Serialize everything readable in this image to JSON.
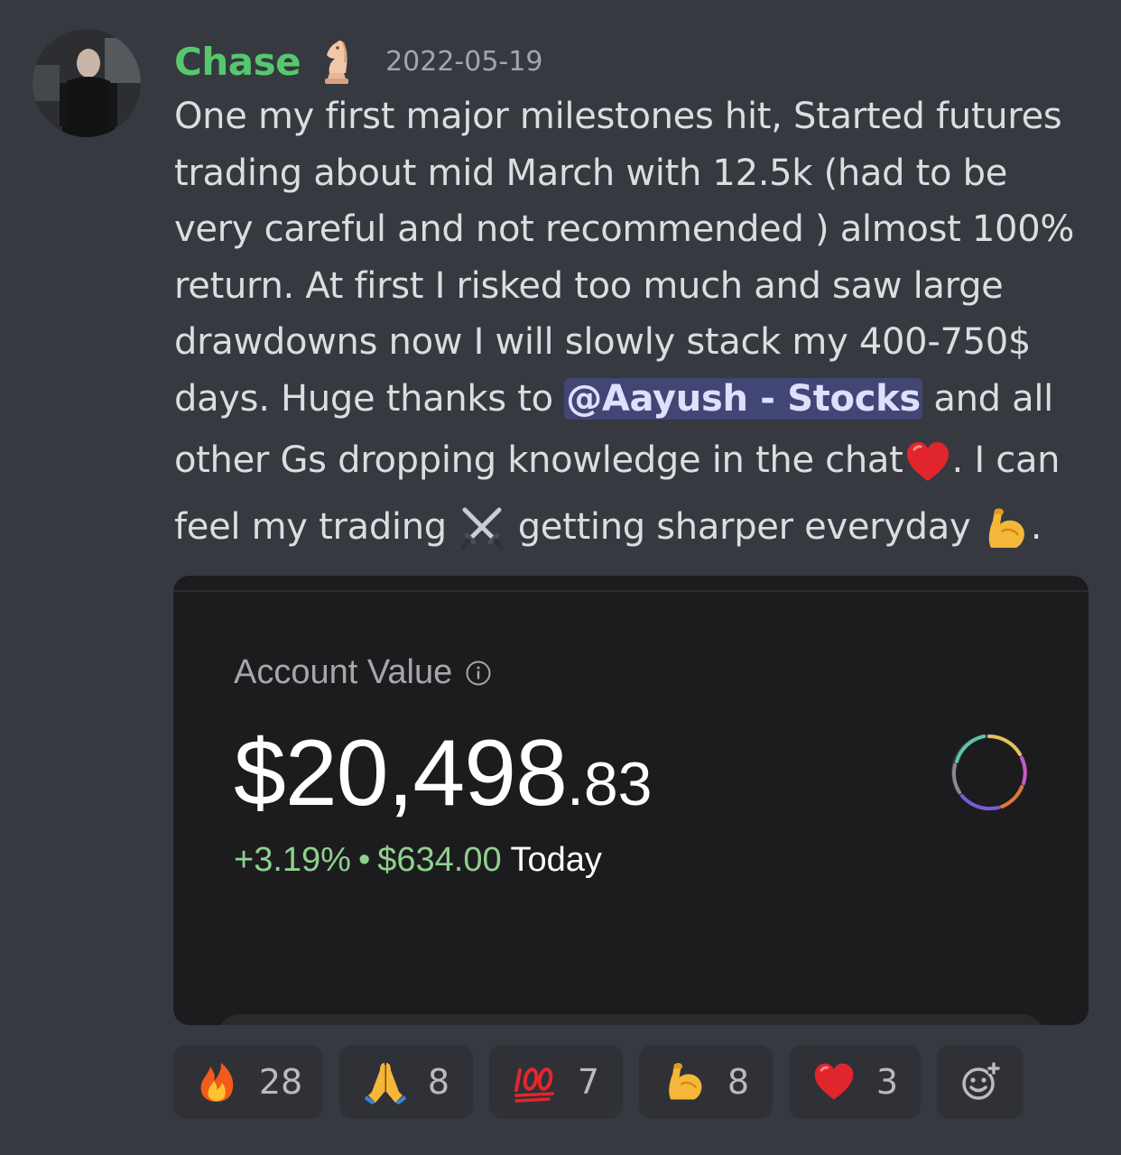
{
  "message": {
    "author": "Chase",
    "timestamp": "2022-05-19",
    "role_icon": "chess-knight-icon",
    "lines": [
      "One my first major milestones hit, Started futures",
      "trading about mid March with 12.5k (had to be",
      "very careful and not recommended ) almost 100%",
      "return. At first I risked too much and saw large",
      "drawdowns now I will slowly stack my 400-750$"
    ],
    "line6_before": "days. Huge thanks to ",
    "mention": "@Aayush - Stocks",
    "line6_after": " and all",
    "line7_before": "other Gs dropping knowledge in the chat",
    "line7_after": ". I can",
    "line8_before": "feel my trading ",
    "line8_middle": " getting sharper everyday ",
    "line8_after": "."
  },
  "attachment": {
    "label": "Account Value",
    "value_main": "$20,498",
    "value_cents": ".83",
    "change_percent": "+3.19%",
    "separator": "•",
    "change_amount": "$634.00",
    "change_period": "Today"
  },
  "reactions": [
    {
      "emoji": "fire-icon",
      "count": "28"
    },
    {
      "emoji": "folded-hands-icon",
      "count": "8"
    },
    {
      "emoji": "hundred-points-icon",
      "count": "7"
    },
    {
      "emoji": "flexed-biceps-icon",
      "count": "8"
    },
    {
      "emoji": "red-heart-icon",
      "count": "3"
    }
  ],
  "colors": {
    "background": "#36393f",
    "username": "#57c76e",
    "mention_bg": "#414675",
    "positive": "#8fd08f",
    "reaction_bg": "#2f3136"
  }
}
